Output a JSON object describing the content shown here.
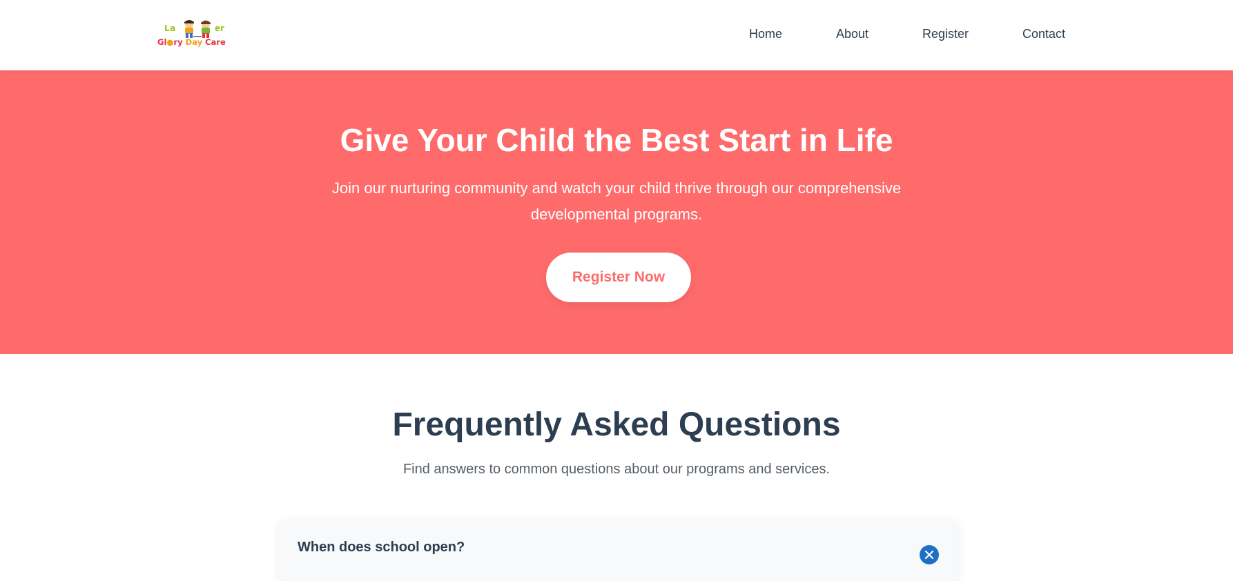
{
  "header": {
    "logo": {
      "line1_left": "La",
      "line1_right": "er",
      "line2_part1": "Gl",
      "line2_part2": "ry",
      "line2_day": "Day",
      "line2_care": "Care"
    },
    "nav": [
      {
        "label": "Home"
      },
      {
        "label": "About"
      },
      {
        "label": "Register"
      },
      {
        "label": "Contact"
      }
    ]
  },
  "hero": {
    "title": "Give Your Child the Best Start in Life",
    "subtitle": "Join our nurturing community and watch your child thrive through our comprehensive developmental programs.",
    "cta_label": "Register Now"
  },
  "faq": {
    "title": "Frequently Asked Questions",
    "subtitle": "Find answers to common questions about our programs and services.",
    "items": [
      {
        "question": "When does school open?",
        "toggle_icon": "close-icon"
      }
    ]
  },
  "colors": {
    "hero_bg": "#ff6b6b",
    "heading": "#2c3e50",
    "toggle": "#1f6fc5"
  }
}
